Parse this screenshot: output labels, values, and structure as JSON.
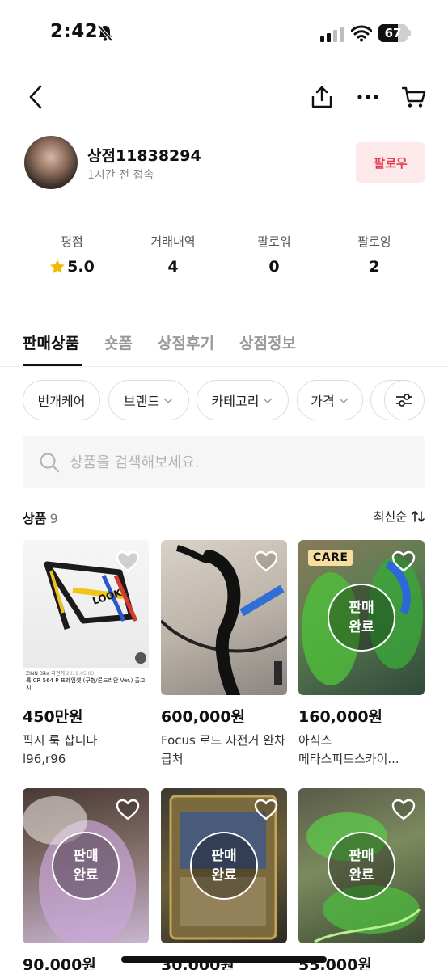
{
  "status_bar": {
    "time": "2:42",
    "battery": "67",
    "battery_level": 0.67
  },
  "profile": {
    "shop_name": "상점11838294",
    "last_seen": "1시간 전 접속",
    "follow_label": "팔로우"
  },
  "stats": [
    {
      "label": "평점",
      "value": "5.0"
    },
    {
      "label": "거래내역",
      "value": "4"
    },
    {
      "label": "팔로워",
      "value": "0"
    },
    {
      "label": "팔로잉",
      "value": "2"
    }
  ],
  "tabs": [
    "판매상품",
    "숏폼",
    "상점후기",
    "상점정보"
  ],
  "filters": [
    "번개케어",
    "브랜드",
    "카테고리",
    "가격"
  ],
  "search": {
    "placeholder": "상품을 검색해보세요."
  },
  "list": {
    "title": "상품",
    "count": "9",
    "sort_label": "최신순"
  },
  "product_image_text": {
    "frame_brand": "LOOK",
    "caption_1": "ZINN Bike 자전거",
    "caption_2": "2019.05.03",
    "caption_3": "룩 CR 564 P 프레임셋 (구형/론드리안 Ver.) 출고시"
  },
  "products": [
    {
      "price": "450만원",
      "title": "픽시 룩 삽니다\nl96,r96",
      "sold": false,
      "care": false
    },
    {
      "price": "600,000원",
      "title": "Focus 로드 자전거 완차 급처",
      "sold": false,
      "care": false
    },
    {
      "price": "160,000원",
      "title": "아식스 메타스피드스카이...",
      "sold": true,
      "care": true
    },
    {
      "price": "90,000원",
      "title": "",
      "sold": true,
      "care": false
    },
    {
      "price": "30,000원",
      "title": "",
      "sold": true,
      "care": false
    },
    {
      "price": "55,000원",
      "title": "",
      "sold": true,
      "care": false
    }
  ],
  "labels": {
    "sold_line1": "판매",
    "sold_line2": "완료",
    "care_tag": "CARE"
  },
  "icons": {
    "back": "chevron-left-icon",
    "share": "share-icon",
    "more": "more-icon",
    "cart": "cart-icon",
    "star": "star-icon",
    "filter": "sliders-icon",
    "search": "search-icon",
    "sort": "sort-icon",
    "like": "heart-icon"
  },
  "colors": {
    "accent": "#e8364a",
    "follow_bg": "#fde8ea",
    "care_bg": "#f7dfa2",
    "star": "#f5b800"
  }
}
